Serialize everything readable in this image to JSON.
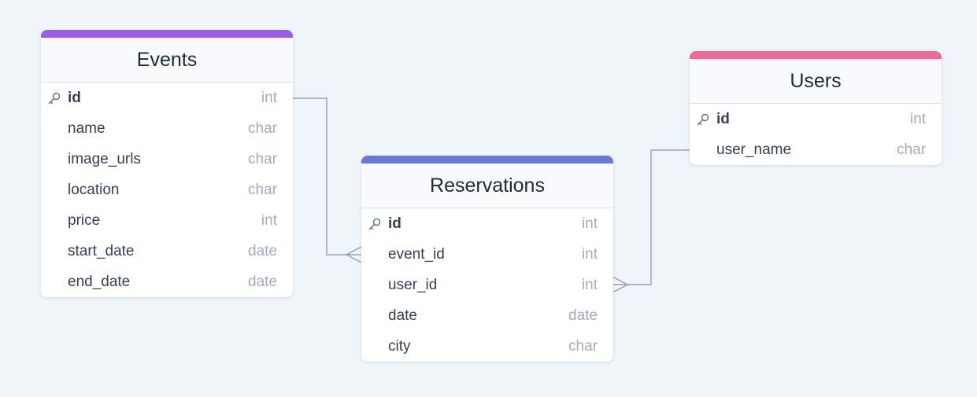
{
  "tables": {
    "events": {
      "title": "Events",
      "accent": "#9b5de5",
      "fields": [
        {
          "name": "id",
          "type": "int",
          "pk": true
        },
        {
          "name": "name",
          "type": "char"
        },
        {
          "name": "image_urls",
          "type": "char"
        },
        {
          "name": "location",
          "type": "char"
        },
        {
          "name": "price",
          "type": "int"
        },
        {
          "name": "start_date",
          "type": "date"
        },
        {
          "name": "end_date",
          "type": "date"
        }
      ]
    },
    "reservations": {
      "title": "Reservations",
      "accent": "#6b77d4",
      "fields": [
        {
          "name": "id",
          "type": "int",
          "pk": true
        },
        {
          "name": "event_id",
          "type": "int"
        },
        {
          "name": "user_id",
          "type": "int"
        },
        {
          "name": "date",
          "type": "date"
        },
        {
          "name": "city",
          "type": "char"
        }
      ]
    },
    "users": {
      "title": "Users",
      "accent": "#f06a97",
      "fields": [
        {
          "name": "id",
          "type": "int",
          "pk": true
        },
        {
          "name": "user_name",
          "type": "char"
        }
      ]
    }
  },
  "relations": [
    {
      "from": "events.id",
      "to": "reservations.event_id",
      "cardinality": "one-to-many"
    },
    {
      "from": "users.id",
      "to": "reservations.user_id",
      "cardinality": "one-to-many"
    }
  ],
  "icons": {
    "primary_key": "key-icon"
  },
  "colors": {
    "background": "#f0f5f9",
    "connector": "#94a3b8"
  }
}
